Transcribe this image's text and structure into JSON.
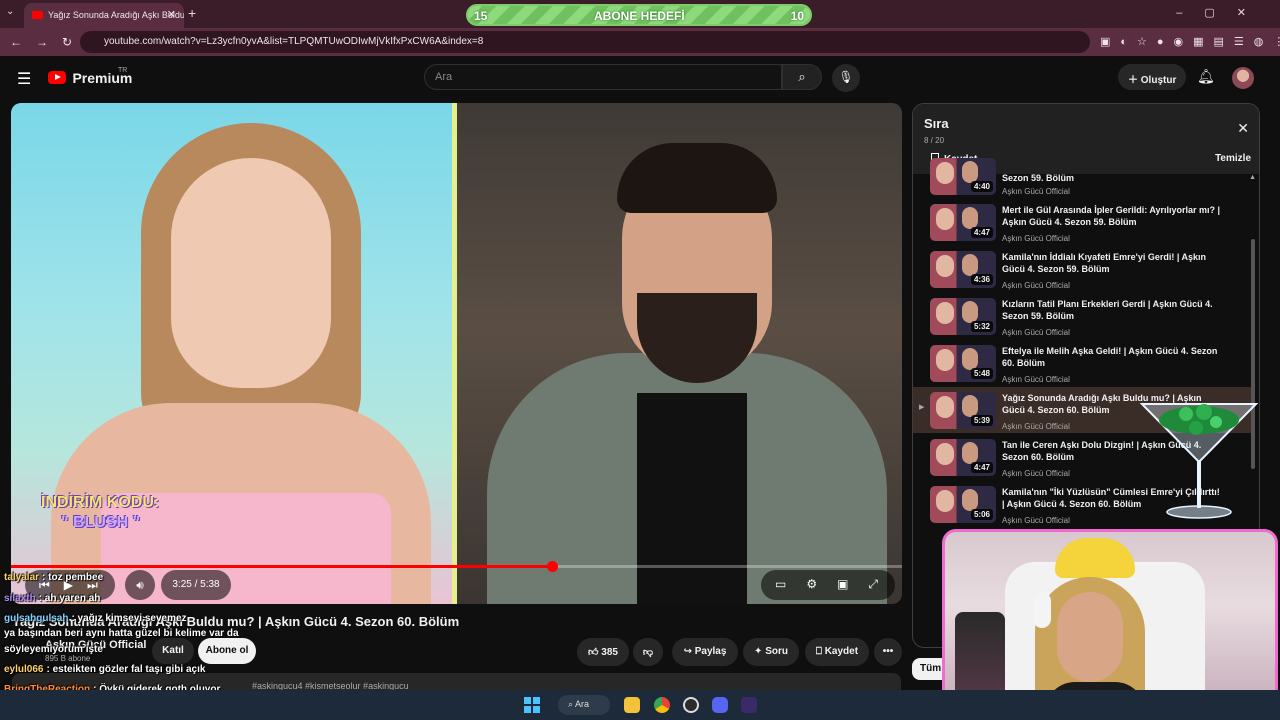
{
  "browser": {
    "tab_title": "Yağız Sonunda Aradığı Aşkı Buldu mu? | Aşkın Gücü 4. Sezon 60. Bölüm",
    "url": "youtube.com/watch?v=Lz3ycfn0yvA&list=TLPQMTUwODIwMjVkIfxPxCW6A&index=8",
    "tab_close": "✕",
    "new_tab": "+",
    "colors": {
      "tabbar": "#3b1d2a",
      "toolbar": "#5a2d40"
    }
  },
  "goal_overlay": {
    "left": "15",
    "label": "ABONE HEDEFİ",
    "right": "10"
  },
  "youtube": {
    "logo_text": "Premium",
    "logo_sup": "TR",
    "search_placeholder": "Ara",
    "create_label": "Oluştur",
    "icons": {
      "menu": "hamburger-icon",
      "search": "search-icon",
      "mic": "mic-icon",
      "bell": "bell-icon"
    }
  },
  "video": {
    "promo_line1": "İNDİRİM KODU:",
    "promo_line2": "\" BLUSH \"",
    "time": "3:25 / 5:38",
    "progress_fraction": 0.607,
    "title": "Yağız Sonunda Aradığı Aşkı Buldu mu? | Aşkın Gücü 4. Sezon 60. Bölüm",
    "channel": "Aşkın Gücü Official",
    "subscribers": "895 B abone",
    "join_label": "Katıl",
    "subscribe_label": "Abone ol",
    "likes": "385",
    "share_label": "Paylaş",
    "ask_label": "Soru",
    "save_label": "Kaydet",
    "description_tags": "#askingucu4 #kismetseolur #askingucu"
  },
  "playlist": {
    "title": "Sıra",
    "count": "8 / 20",
    "save_label": "Kaydet",
    "clear_label": "Temizle",
    "items": [
      {
        "title": "Sezon 59. Bölüm",
        "channel": "Aşkın Gücü Official",
        "duration": "4:40",
        "current": false
      },
      {
        "title": "Mert ile Gül Arasında İpler Gerildi: Ayrılıyorlar mı? | Aşkın Gücü 4. Sezon 59. Bölüm",
        "channel": "Aşkın Gücü Official",
        "duration": "4:47",
        "current": false
      },
      {
        "title": "Kamila'nın İddialı Kıyafeti Emre'yi Gerdi! | Aşkın Gücü 4. Sezon 59. Bölüm",
        "channel": "Aşkın Gücü Official",
        "duration": "4:36",
        "current": false
      },
      {
        "title": "Kızların Tatil Planı Erkekleri Gerdi | Aşkın Gücü 4. Sezon 59. Bölüm",
        "channel": "Aşkın Gücü Official",
        "duration": "5:32",
        "current": false
      },
      {
        "title": "Eftelya ile Melih Aşka Geldi! | Aşkın Gücü 4. Sezon 60. Bölüm",
        "channel": "Aşkın Gücü Official",
        "duration": "5:48",
        "current": false
      },
      {
        "title": "Yağız Sonunda Aradığı Aşkı Buldu mu? | Aşkın Gücü 4. Sezon 60. Bölüm",
        "channel": "Aşkın Gücü Official",
        "duration": "5:39",
        "current": true
      },
      {
        "title": "Tan ile Ceren Aşkı Dolu Dizgin! | Aşkın Gücü 4. Sezon 60. Bölüm",
        "channel": "Aşkın Gücü Official",
        "duration": "4:47",
        "current": false
      },
      {
        "title": "Kamila'nın \"İki Yüzlüsün\" Cümlesi Emre'yi Çıldırttı! | Aşkın Gücü 4. Sezon 60. Bölüm",
        "channel": "Aşkın Gücü Official",
        "duration": "5:06",
        "current": false
      }
    ]
  },
  "chat": [
    {
      "user": "talyalar",
      "text": ": toz pembee"
    },
    {
      "user": "silaxth",
      "text": ": ah yaren ah"
    },
    {
      "user": "gulsahgulsah",
      "text": ": yağız kimseyi sevemez"
    },
    {
      "user": "",
      "text": "ya başından beri aynı hatta güzel bi kelime var da"
    },
    {
      "user": "",
      "text": "söyleyemiyorum işte"
    },
    {
      "user": "eylul066",
      "text": ": esteikten gözler fal taşı gibi açık"
    },
    {
      "user": "BringTheReaction",
      "text": ": Öykü giderek goth oluyor"
    }
  ],
  "chat_colors": {
    "talyalar": "#ffd36b",
    "silaxth": "#b388ff",
    "gulsahgulsah": "#7fd3ff",
    "eylul066": "#ffd36b",
    "BringTheReaction": "#ff8a3d"
  },
  "other": {
    "tum_label": "Tüm"
  },
  "taskbar": {
    "search_label": "Ara"
  }
}
